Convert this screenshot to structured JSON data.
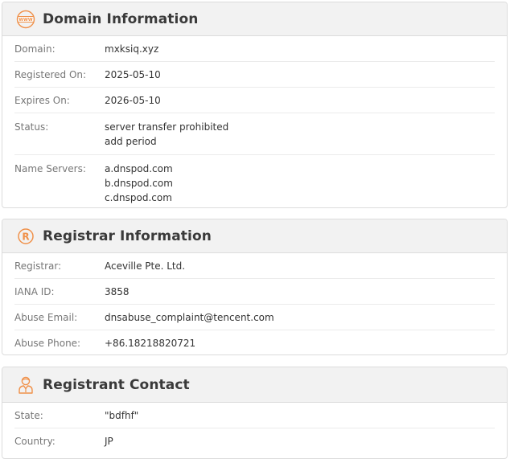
{
  "domain_section": {
    "title": "Domain Information",
    "icon": "www-globe-icon",
    "rows": [
      {
        "label": "Domain:",
        "values": [
          "mxksiq.xyz"
        ]
      },
      {
        "label": "Registered On:",
        "values": [
          "2025-05-10"
        ]
      },
      {
        "label": "Expires On:",
        "values": [
          "2026-05-10"
        ]
      },
      {
        "label": "Status:",
        "values": [
          "server transfer prohibited",
          "add period"
        ]
      },
      {
        "label": "Name Servers:",
        "values": [
          "a.dnspod.com",
          "b.dnspod.com",
          "c.dnspod.com"
        ]
      }
    ]
  },
  "registrar_section": {
    "title": "Registrar Information",
    "icon": "registered-icon",
    "rows": [
      {
        "label": "Registrar:",
        "values": [
          "Aceville Pte. Ltd."
        ]
      },
      {
        "label": "IANA ID:",
        "values": [
          "3858"
        ]
      },
      {
        "label": "Abuse Email:",
        "values": [
          "dnsabuse_complaint@tencent.com"
        ]
      },
      {
        "label": "Abuse Phone:",
        "values": [
          "+86.18218820721"
        ]
      }
    ]
  },
  "registrant_section": {
    "title": "Registrant Contact",
    "icon": "person-icon",
    "rows": [
      {
        "label": "State:",
        "values": [
          "\"bdfhf\""
        ]
      },
      {
        "label": "Country:",
        "values": [
          "JP"
        ]
      }
    ]
  },
  "colors": {
    "accent": "#f0914a",
    "header_bg": "#f2f2f2",
    "border": "#dcdcdc"
  }
}
